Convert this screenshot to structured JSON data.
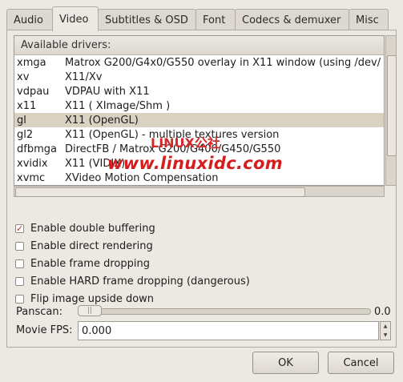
{
  "tabs": [
    {
      "label": "Audio"
    },
    {
      "label": "Video"
    },
    {
      "label": "Subtitles & OSD"
    },
    {
      "label": "Font"
    },
    {
      "label": "Codecs & demuxer"
    },
    {
      "label": "Misc"
    }
  ],
  "drivers": {
    "header": "Available drivers:",
    "rows": [
      {
        "name": "xmga",
        "description": "Matrox G200/G4x0/G550 overlay in X11 window (using /dev/"
      },
      {
        "name": "xv",
        "description": "X11/Xv"
      },
      {
        "name": "vdpau",
        "description": "VDPAU with X11"
      },
      {
        "name": "x11",
        "description": "X11 ( XImage/Shm )"
      },
      {
        "name": "gl",
        "description": "X11 (OpenGL)",
        "selected": true
      },
      {
        "name": "gl2",
        "description": "X11 (OpenGL) - multiple textures version"
      },
      {
        "name": "dfbmga",
        "description": "DirectFB / Matrox G200/G400/G450/G550"
      },
      {
        "name": "xvidix",
        "description": "X11 (VIDIX)"
      },
      {
        "name": "xvmc",
        "description": "XVideo Motion Compensation"
      }
    ]
  },
  "watermark": {
    "line1": "LINUX公社",
    "line2": "www.linuxidc.com"
  },
  "options": [
    {
      "label": "Enable double buffering",
      "checked": true
    },
    {
      "label": "Enable direct rendering",
      "checked": false
    },
    {
      "label": "Enable frame dropping",
      "checked": false
    },
    {
      "label": "Enable HARD frame dropping (dangerous)",
      "checked": false
    },
    {
      "label": "Flip image upside down",
      "checked": false
    }
  ],
  "panscan": {
    "label": "Panscan:",
    "value": "0.0"
  },
  "fps": {
    "label": "Movie FPS:",
    "value": "0.000"
  },
  "buttons": {
    "ok": "OK",
    "cancel": "Cancel"
  },
  "colors": {
    "selected_row": "#d9d2c3",
    "check_mark": "#b62e1d",
    "watermark": "#d61d1d"
  }
}
